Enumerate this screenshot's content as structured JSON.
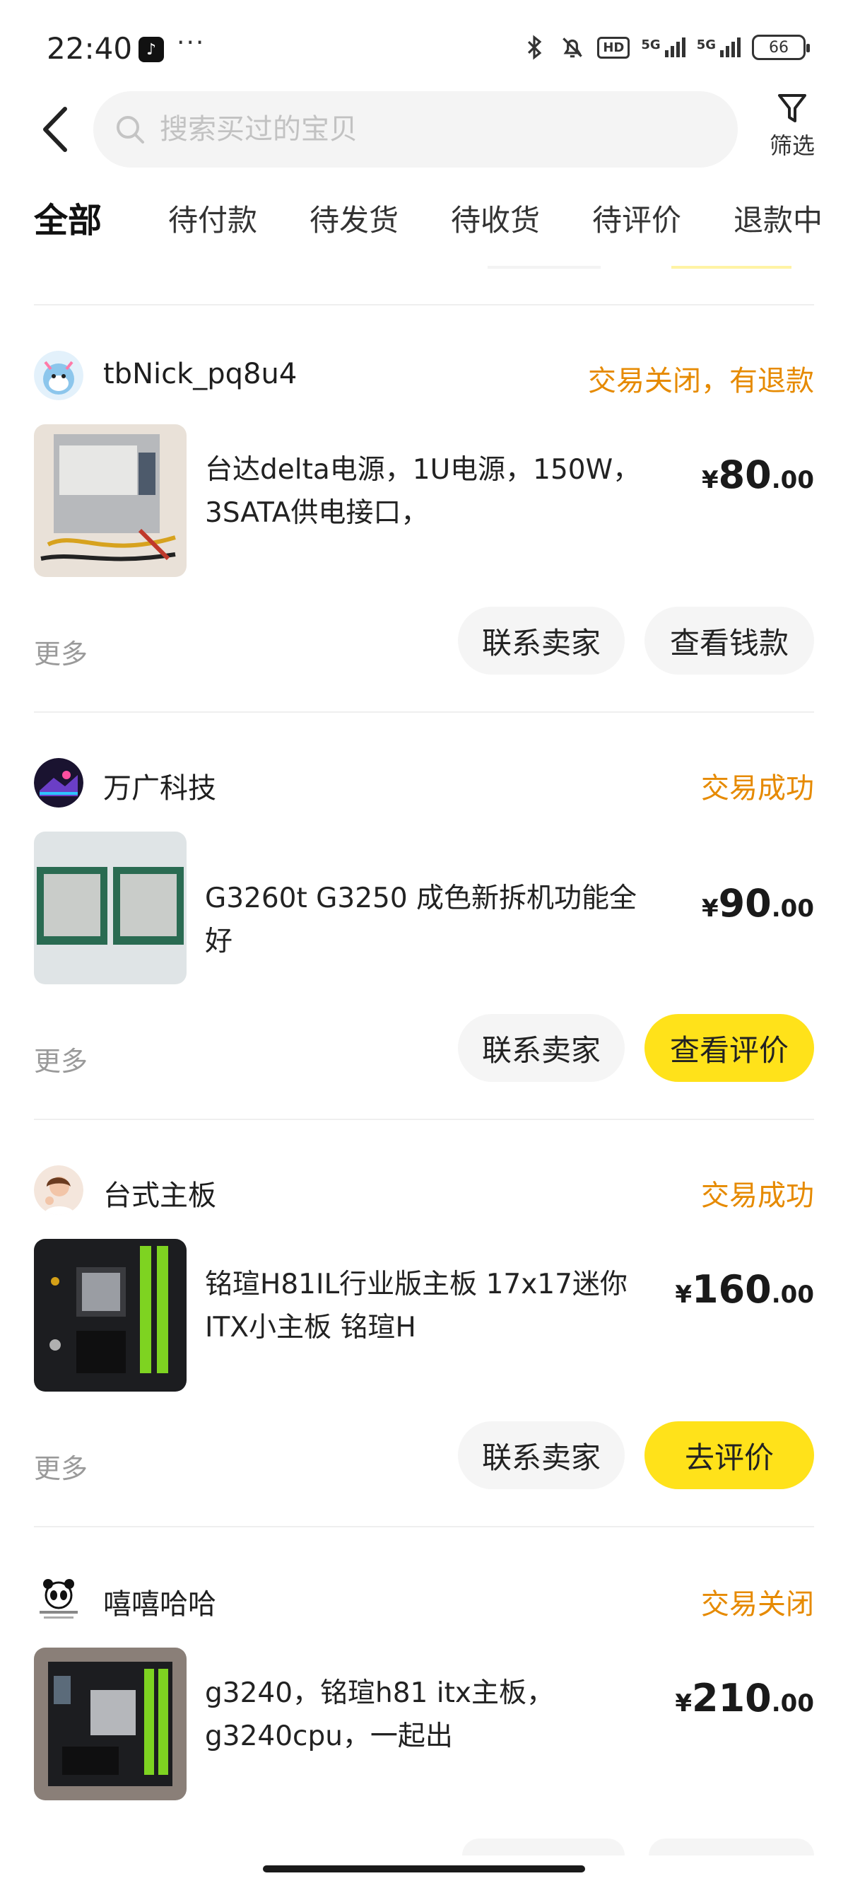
{
  "status_bar": {
    "time": "22:40",
    "app_icon": "tiktok-icon",
    "overflow": "···",
    "hd_label": "HD",
    "net1_label": "5G",
    "net2_label": "5G",
    "battery": "66"
  },
  "header": {
    "search_placeholder": "搜索买过的宝贝",
    "filter_label": "筛选"
  },
  "tabs": [
    {
      "label": "全部",
      "active": true
    },
    {
      "label": "待付款",
      "active": false
    },
    {
      "label": "待发货",
      "active": false
    },
    {
      "label": "待收货",
      "active": false
    },
    {
      "label": "待评价",
      "active": false
    },
    {
      "label": "退款中",
      "active": false
    }
  ],
  "orders": [
    {
      "shop": "tbNick_pq8u4",
      "status": "交易关闭，有退款",
      "title": "台达delta电源，1U电源，150W，3SATA供电接口，",
      "price_currency": "¥",
      "price_int": "80",
      "price_dec": ".00",
      "more": "更多",
      "btn1": "联系卖家",
      "btn2": "查看钱款",
      "btn2_style": "secondary"
    },
    {
      "shop": "万广科技",
      "status": "交易成功",
      "title": "G3260t G3250 成色新拆机功能全好",
      "price_currency": "¥",
      "price_int": "90",
      "price_dec": ".00",
      "more": "更多",
      "btn1": "联系卖家",
      "btn2": "查看评价",
      "btn2_style": "primary"
    },
    {
      "shop": "台式主板",
      "status": "交易成功",
      "title": "铭瑄H81IL行业版主板 17x17迷你ITX小主板 铭瑄H",
      "price_currency": "¥",
      "price_int": "160",
      "price_dec": ".00",
      "more": "更多",
      "btn1": "联系卖家",
      "btn2": "去评价",
      "btn2_style": "primary"
    },
    {
      "shop": "嘻嘻哈哈",
      "status": "交易关闭",
      "title": "g3240，铭瑄h81 itx主板，g3240cpu，一起出",
      "price_currency": "¥",
      "price_int": "210",
      "price_dec": ".00"
    }
  ],
  "colors": {
    "accent_yellow": "#ffe21a",
    "status_orange": "#e68a00",
    "muted_text": "#9a9a9a"
  }
}
